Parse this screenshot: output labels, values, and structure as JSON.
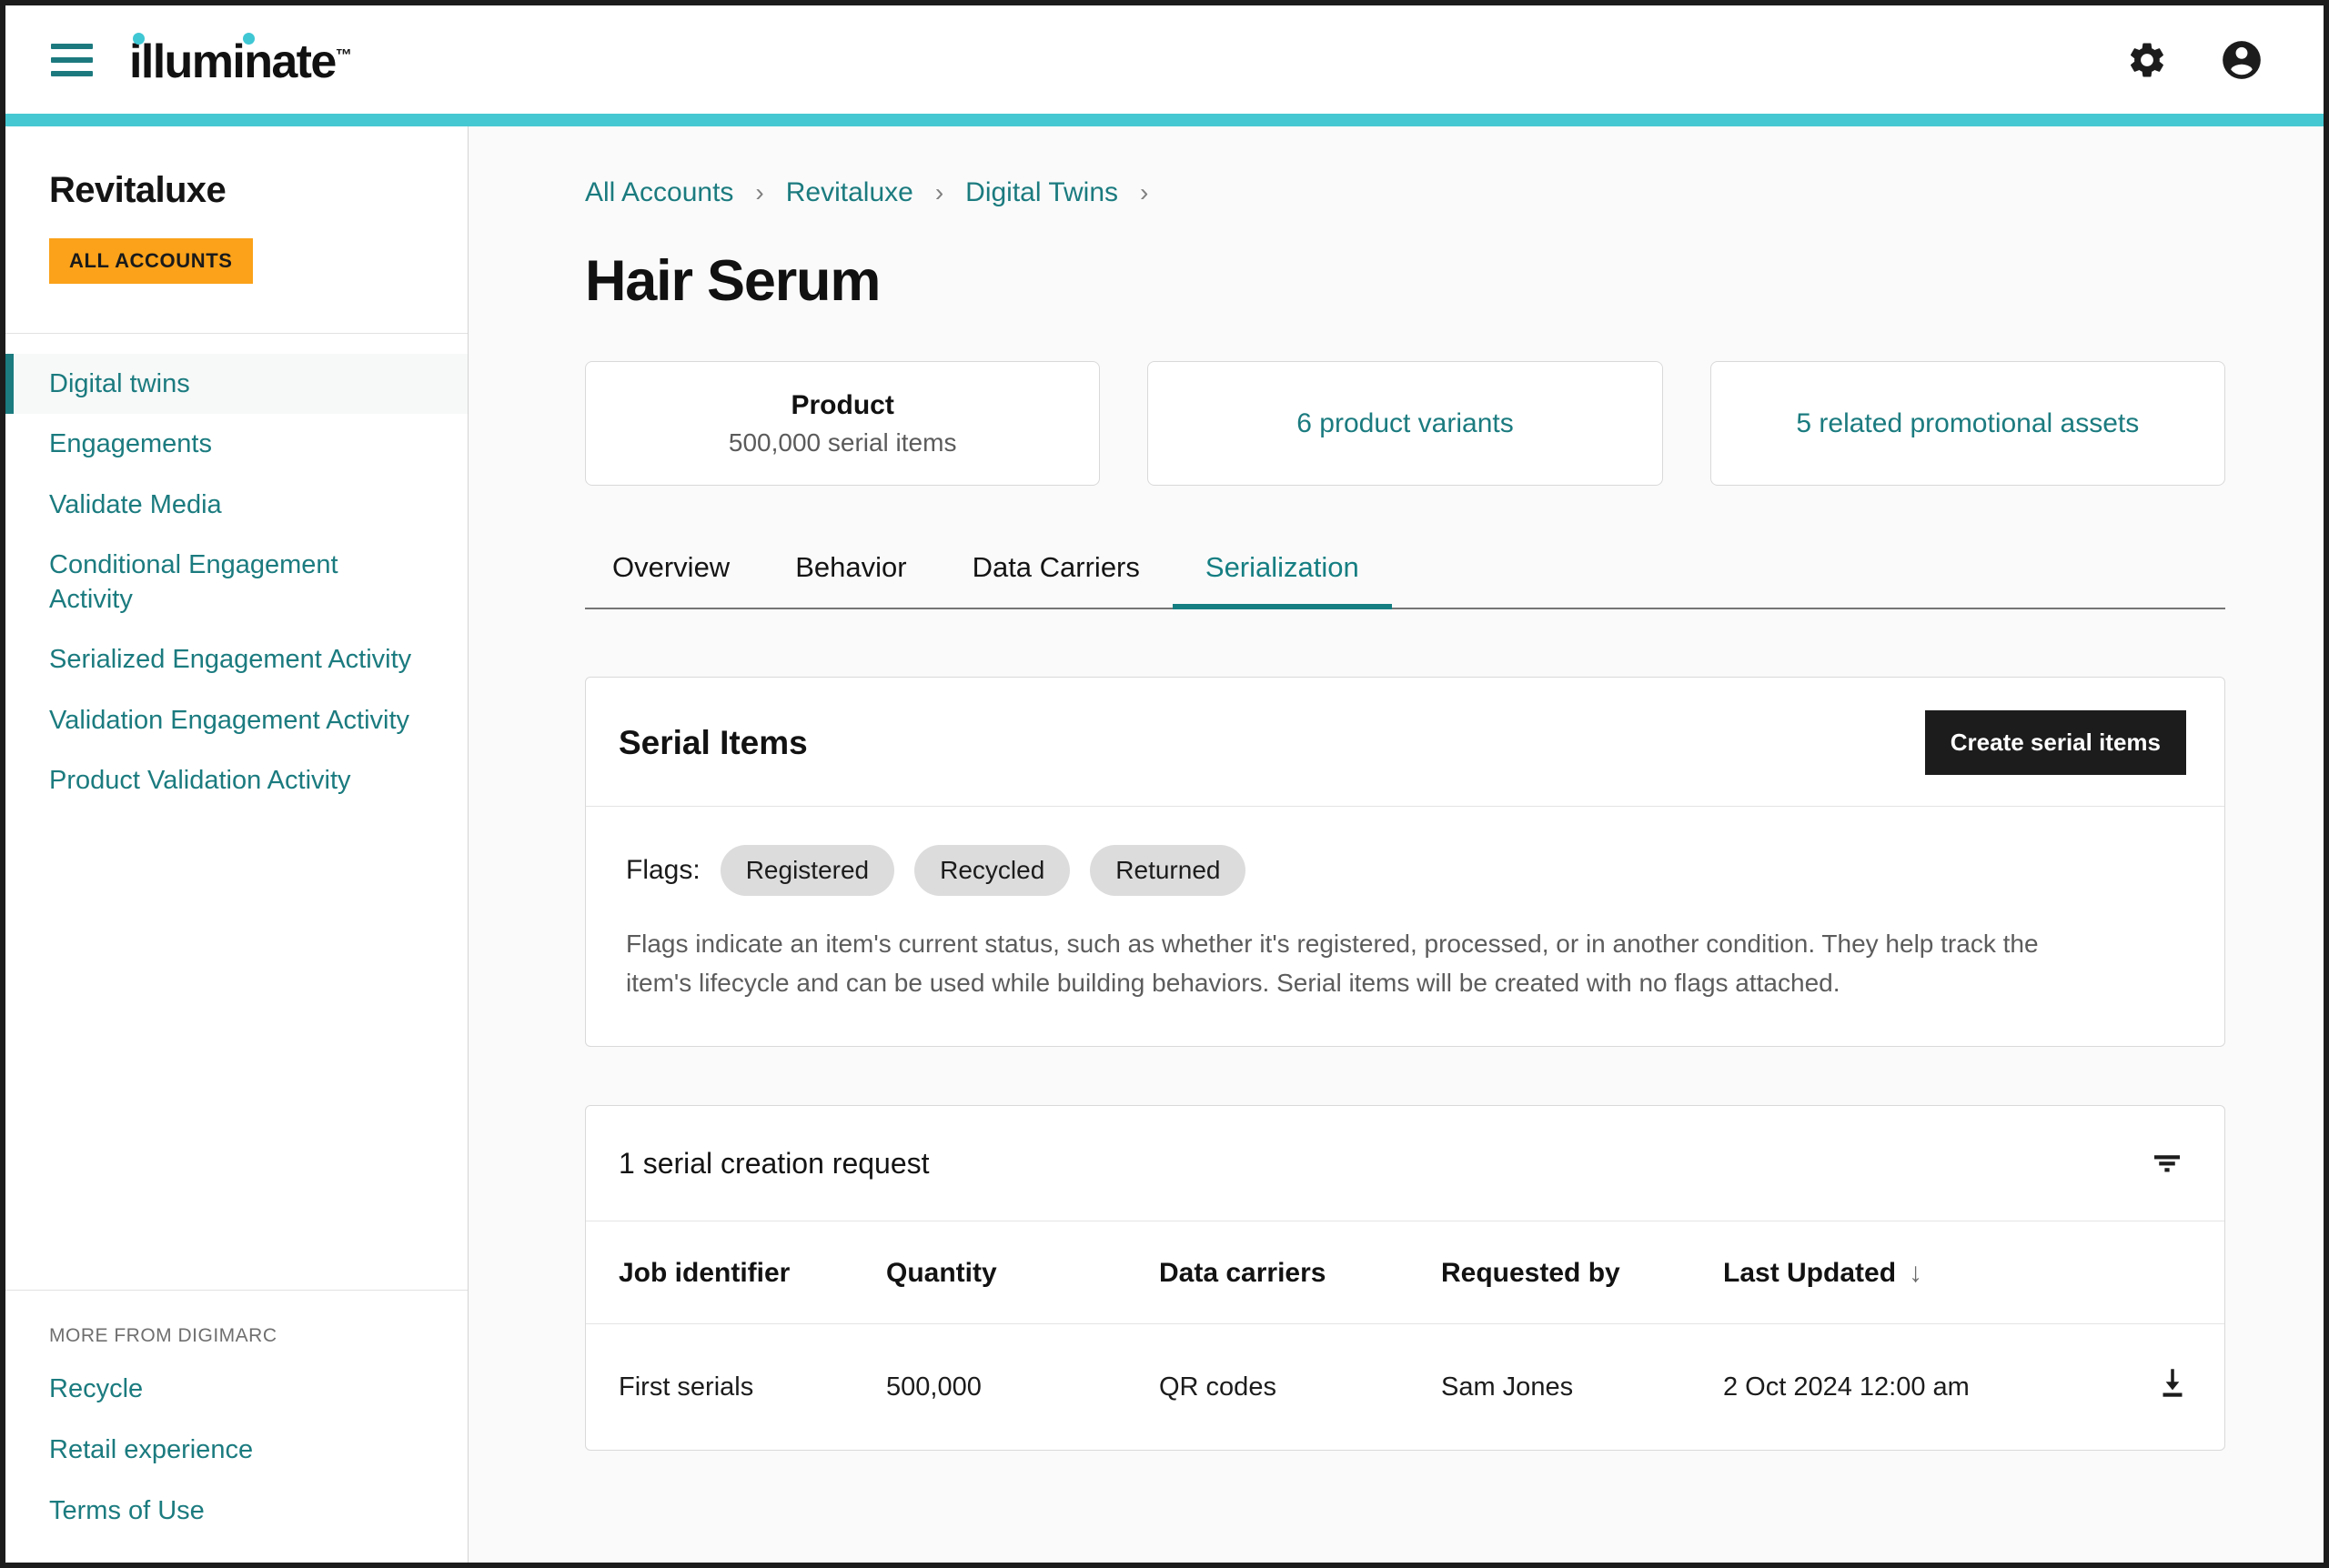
{
  "topbar": {
    "menu_icon": "hamburger-menu-icon",
    "logo_text": "illuminate",
    "logo_tm": "™",
    "settings_icon": "gear-icon",
    "account_icon": "account-circle-icon",
    "accent_color": "#46c8d2"
  },
  "sidebar": {
    "account_name": "Revitaluxe",
    "all_accounts_label": "ALL ACCOUNTS",
    "items": [
      {
        "label": "Digital twins",
        "active": true
      },
      {
        "label": "Engagements",
        "active": false
      },
      {
        "label": "Validate Media",
        "active": false
      },
      {
        "label": "Conditional Engagement Activity",
        "active": false
      },
      {
        "label": "Serialized Engagement Activity",
        "active": false
      },
      {
        "label": "Validation Engagement Activity",
        "active": false
      },
      {
        "label": "Product Validation Activity",
        "active": false
      }
    ],
    "more_title": "MORE FROM DIGIMARC",
    "more_links": [
      "Recycle",
      "Retail experience",
      "Terms of Use"
    ],
    "link_color": "#1b7b7f",
    "badge_color": "#fba21a"
  },
  "breadcrumb": {
    "items": [
      "All Accounts",
      "Revitaluxe",
      "Digital Twins"
    ],
    "separator": "›",
    "trailing_separator": "›"
  },
  "page": {
    "title": "Hair Serum"
  },
  "cards": [
    {
      "title": "Product",
      "subtitle": "500,000 serial items",
      "is_link": false
    },
    {
      "title": "6 product variants",
      "subtitle": "",
      "is_link": true
    },
    {
      "title": "5 related promotional assets",
      "subtitle": "",
      "is_link": true
    }
  ],
  "tabs": [
    {
      "label": "Overview",
      "active": false
    },
    {
      "label": "Behavior",
      "active": false
    },
    {
      "label": "Data Carriers",
      "active": false
    },
    {
      "label": "Serialization",
      "active": true
    }
  ],
  "serial_items_panel": {
    "title": "Serial Items",
    "create_button": "Create serial items",
    "flags_label": "Flags:",
    "flags": [
      "Registered",
      "Recycled",
      "Returned"
    ],
    "description": "Flags indicate an item's current status, such as whether it's registered, processed, or in another condition. They help track the item's lifecycle and can be used while building behaviors. Serial items will be created with no flags attached."
  },
  "requests_panel": {
    "heading": "1 serial creation request",
    "filter_icon": "filter-icon",
    "columns": [
      "Job identifier",
      "Quantity",
      "Data carriers",
      "Requested by",
      "Last Updated"
    ],
    "sort_column": "Last Updated",
    "sort_arrow": "↓",
    "rows": [
      {
        "job_identifier": "First serials",
        "quantity": "500,000",
        "data_carriers": "QR codes",
        "requested_by": "Sam Jones",
        "last_updated": "2 Oct 2024 12:00 am",
        "action_icon": "download-icon"
      }
    ]
  }
}
